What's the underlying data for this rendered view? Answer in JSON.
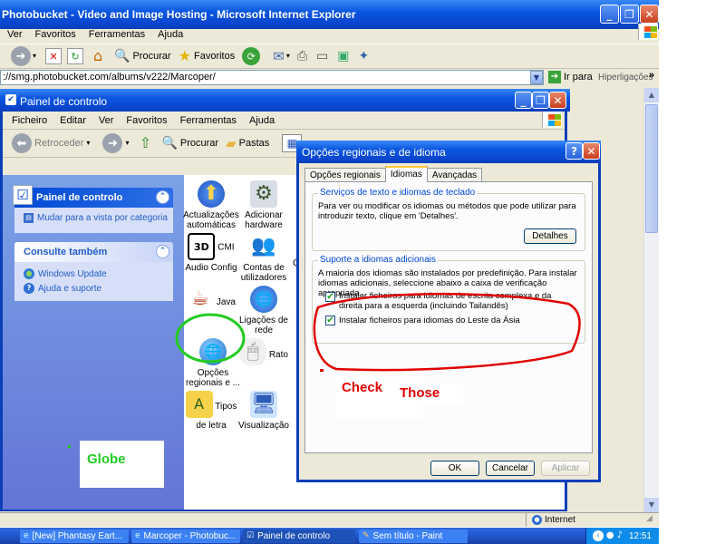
{
  "ie": {
    "title": "Photobucket - Video and Image Hosting - Microsoft Internet Explorer",
    "menu": [
      "Ver",
      "Favoritos",
      "Ferramentas",
      "Ajuda"
    ],
    "toolbar": {
      "search": "Procurar",
      "favorites": "Favoritos"
    },
    "address": {
      "url": "://smg.photobucket.com/albums/v222/Marcoper/",
      "go": "Ir para",
      "links": "Hiperligações"
    },
    "status": {
      "zone": "Internet"
    }
  },
  "control_panel": {
    "title": "Painel de controlo",
    "menu": [
      "Ficheiro",
      "Editar",
      "Ver",
      "Favoritos",
      "Ferramentas",
      "Ajuda"
    ],
    "toolbar": {
      "back": "Retroceder",
      "search": "Procurar",
      "folders": "Pastas"
    },
    "left": {
      "panel1": {
        "title": "Painel de controlo",
        "link": "Mudar para a vista por categoria"
      },
      "panel2": {
        "title": "Consulte também",
        "links": [
          "Windows Update",
          "Ajuda e suporte"
        ]
      }
    },
    "items": [
      {
        "label": "Actualizações automáticas"
      },
      {
        "label": "Adicionar hardware"
      },
      {
        "label": "CMI Audio Config"
      },
      {
        "label": "Contas de utilizadores"
      },
      {
        "label": "Java"
      },
      {
        "label": "Ligações de rede"
      },
      {
        "label": "Opções regionais e ..."
      },
      {
        "label": "Rato"
      },
      {
        "label": "Tipos de letra"
      },
      {
        "label": "Visualização"
      }
    ],
    "cut_letters": [
      "A",
      "C"
    ]
  },
  "dialog": {
    "title": "Opções regionais e de idioma",
    "tabs": [
      "Opções regionais",
      "Idiomas",
      "Avançadas"
    ],
    "active_tab": "Idiomas",
    "group1": {
      "legend": "Serviços de texto e idiomas de teclado",
      "text": "Para ver ou modificar os idiomas ou métodos que pode utilizar para introduzir texto, clique em 'Detalhes'.",
      "button": "Detalhes"
    },
    "group2": {
      "legend": "Suporte a idiomas adicionais",
      "text": "A maioria dos idiomas são instalados por predefinição. Para instalar idiomas adicionais, seleccione abaixo a caixa de verificação apropriada.",
      "checkbox1": "Instalar ficheiros para idiomas de escrita complexa e da direita para a esquerda (incluindo Tailandês)",
      "checkbox2": "Instalar ficheiros para idiomas do Leste da Ásia",
      "checkbox1_checked": true,
      "checkbox2_checked": true
    },
    "buttons": {
      "ok": "OK",
      "cancel": "Cancelar",
      "apply": "Aplicar"
    }
  },
  "annotations": {
    "check": "Check",
    "those": "Those",
    "globe": "Globe"
  },
  "taskbar": {
    "tasks": [
      "[New] Phantasy Eart...",
      "Marcoper - Photobuc...",
      "Painel de controlo",
      "Sem título - Paint"
    ],
    "active": "Painel de controlo",
    "clock": "12:51"
  },
  "colors": {
    "xp_blue": "#0a56e0",
    "annotation_red": "#e00000",
    "annotation_green": "#22cc22",
    "cp_left": "#7ba2e7"
  }
}
